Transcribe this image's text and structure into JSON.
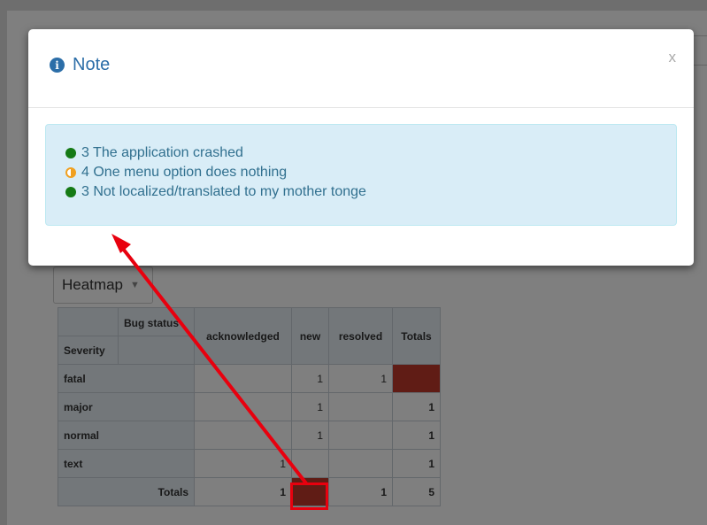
{
  "background": {
    "view_select": "Heatmap",
    "pivot": {
      "corner_col_label": "Bug status",
      "corner_row_label": "Severity",
      "columns": [
        "acknowledged",
        "new",
        "resolved",
        "Totals"
      ],
      "rows": [
        {
          "label": "fatal",
          "cells": [
            "",
            "1",
            "1",
            "2"
          ]
        },
        {
          "label": "major",
          "cells": [
            "",
            "1",
            "",
            "1"
          ]
        },
        {
          "label": "normal",
          "cells": [
            "",
            "1",
            "",
            "1"
          ]
        },
        {
          "label": "text",
          "cells": [
            "1",
            "",
            "",
            "1"
          ]
        }
      ],
      "totals": {
        "label": "Totals",
        "cells": [
          "1",
          "3",
          "1",
          "5"
        ]
      }
    }
  },
  "modal": {
    "title": "Note",
    "close_label": "x",
    "notes": [
      {
        "text": "3 The application crashed",
        "status_color": "#157a15"
      },
      {
        "text": "4 One menu option does nothing",
        "status_color": "#f0a020"
      },
      {
        "text": "3 Not localized/translated to my mother tonge",
        "status_color": "#157a15"
      }
    ]
  },
  "colors": {
    "accent": "#2c6ea8",
    "annotation": "#e8000e",
    "heat": "#c0392b"
  }
}
